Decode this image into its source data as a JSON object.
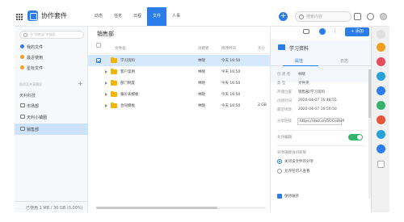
{
  "topbar": {
    "app_title": "协作套件",
    "search_placeholder": "搜索内容",
    "tabs": [
      {
        "label": "动态"
      },
      {
        "label": "任务"
      },
      {
        "label": "日程"
      },
      {
        "label": "文件"
      },
      {
        "label": "人事"
      }
    ],
    "active_tab": "文件"
  },
  "sidebar": {
    "search_placeholder": "在\"销售部\"中搜索",
    "items": [
      {
        "label": "我的文件",
        "color": "#2b7de9"
      },
      {
        "label": "最近使用",
        "color": "#f0a020"
      },
      {
        "label": "星标文件",
        "color": "#f0a020"
      }
    ],
    "section": "投资及共享情况",
    "group": "天利科技",
    "depts": [
      {
        "label": "市场部"
      },
      {
        "label": "天利小镇圈"
      },
      {
        "label": "销售部"
      }
    ],
    "storage": "已使用 1 MB / 30 GB (0.00%)"
  },
  "main": {
    "title": "销售部",
    "columns": [
      "文件名",
      "创建者",
      "修改时间",
      "大小"
    ],
    "rows": [
      {
        "name": "学习资料",
        "creator": "林晓",
        "time": "今天 16:50",
        "size": "",
        "selected": true,
        "expand": false
      },
      {
        "name": "客户案例",
        "creator": "林晓",
        "time": "今天 16:50",
        "size": "",
        "selected": false,
        "expand": true
      },
      {
        "name": "部门制度",
        "creator": "林晓",
        "time": "今天 16:50",
        "size": "",
        "selected": false,
        "expand": true
      },
      {
        "name": "报价表模板",
        "creator": "林晓",
        "time": "今天 16:50",
        "size": "",
        "selected": false,
        "expand": true
      },
      {
        "name": "合同模板",
        "creator": "林晓",
        "time": "今天 16:50",
        "size": "2 GB",
        "selected": false,
        "expand": true
      }
    ]
  },
  "detail": {
    "add_label": "+ 添加",
    "name": "学习资料",
    "tabs": [
      "属性",
      "日志"
    ],
    "props": [
      {
        "k": "创 建 者",
        "v": "林晓"
      },
      {
        "k": "类    型",
        "v": "文件夹"
      },
      {
        "k": "存储位置",
        "v": "销售部/学习资料"
      },
      {
        "k": "创建时间",
        "v": "2020-04-07 16:48:55"
      },
      {
        "k": "最近修改",
        "v": "2020-04-07 16:50:50"
      }
    ],
    "share_label": "分享链接",
    "share_link": "https://dwz.cn/5OCuIAvP",
    "allow_edit": "允许编辑",
    "perm_title": "分享链接访问权限",
    "options": [
      "关闭该文件的分享",
      "允许任何人查看"
    ],
    "keep_open": "保持展开"
  },
  "strip": {
    "colors": [
      "#e0e0e0",
      "#f0a020",
      "#e84a5f",
      "#2aa0d8",
      "#2b7de9",
      "#34b36a",
      "#e8543a",
      "#2aa0d8",
      "#2b7de9"
    ]
  }
}
